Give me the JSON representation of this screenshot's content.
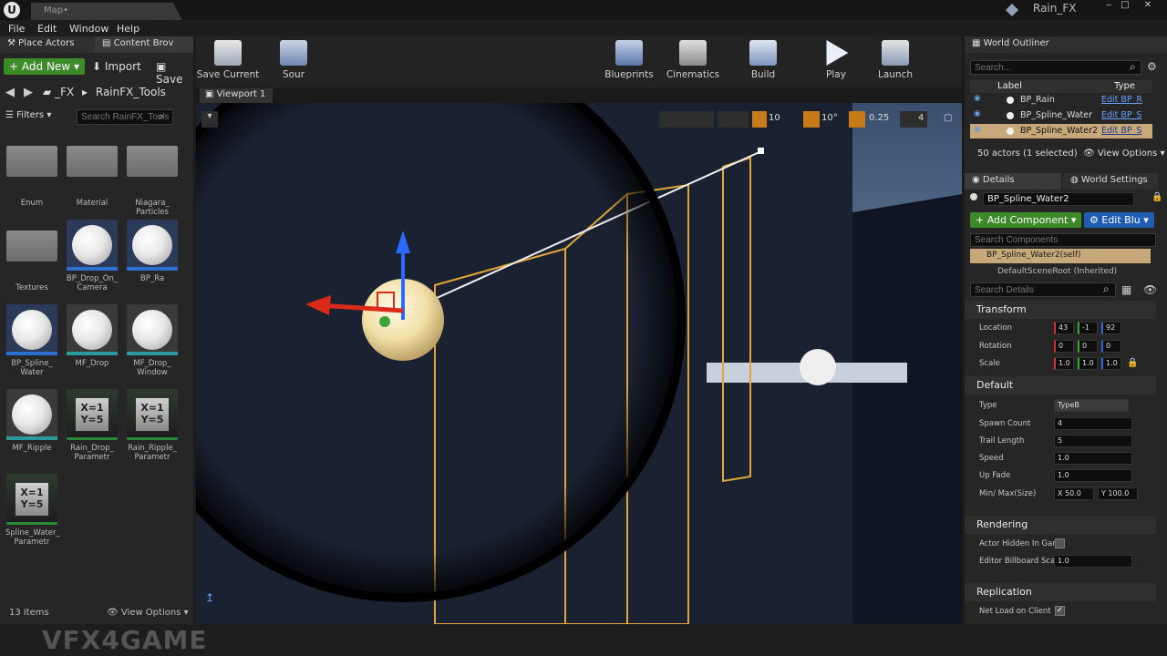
{
  "window": {
    "doc_tab": "Map•",
    "project": "Rain_FX",
    "logo": "U"
  },
  "menu": [
    "File",
    "Edit",
    "Window",
    "Help"
  ],
  "left": {
    "tabs": [
      "Place Actors",
      "Content Brov"
    ],
    "add_new": "Add New",
    "import": "Import",
    "save": "Save",
    "path": [
      "_FX",
      "RainFX_Tools"
    ],
    "filters": "Filters",
    "search_placeholder": "Search RainFX_Tools",
    "assets": [
      {
        "label": "Enum",
        "kind": "folder"
      },
      {
        "label": "Material",
        "kind": "folder"
      },
      {
        "label": "Niagara_ Particles",
        "kind": "folder"
      },
      {
        "label": "Textures",
        "kind": "folder"
      },
      {
        "label": "BP_Drop_On_ Camera",
        "kind": "sphere-bp"
      },
      {
        "label": "BP_Ra",
        "kind": "sphere-bp"
      },
      {
        "label": "BP_Spline_ Water",
        "kind": "sphere-bp"
      },
      {
        "label": "MF_Drop",
        "kind": "sphere-mf"
      },
      {
        "label": "MF_Drop_ Window",
        "kind": "sphere-mf"
      },
      {
        "label": "MF_Ripple",
        "kind": "sphere-mf"
      },
      {
        "label": "Rain_Drop_ Parametr",
        "kind": "param"
      },
      {
        "label": "Rain_Ripple_ Parametr",
        "kind": "param"
      },
      {
        "label": "Spline_Water_ Parametr",
        "kind": "param"
      }
    ],
    "param_icon": "X=1\nY=5",
    "items_count": "13 items",
    "view_options": "View Options"
  },
  "toolbar": [
    {
      "label": "Save Current",
      "icon": "save-icon"
    },
    {
      "label": "Sour",
      "icon": "source-control-icon"
    },
    {
      "label": "Blueprints",
      "icon": "blueprints-icon"
    },
    {
      "label": "Cinematics",
      "icon": "cinematics-icon"
    },
    {
      "label": "Build",
      "icon": "build-icon"
    },
    {
      "label": "Play",
      "icon": "play-icon"
    },
    {
      "label": "Launch",
      "icon": "launch-icon"
    }
  ],
  "viewport": {
    "tab": "Viewport 1",
    "grid": "10",
    "angle": "10°",
    "scale": "0.25",
    "cam": "4"
  },
  "outliner": {
    "title": "World Outliner",
    "search_placeholder": "Search...",
    "col_label": "Label",
    "col_type": "Type",
    "rows": [
      {
        "label": "BP_Rain",
        "type": "Edit BP_R",
        "selected": false
      },
      {
        "label": "BP_Spline_Water",
        "type": "Edit BP_S",
        "selected": false
      },
      {
        "label": "BP_Spline_Water2",
        "type": "Edit BP_S",
        "selected": true
      }
    ],
    "count": "50 actors (1 selected)",
    "view_options": "View Options"
  },
  "details": {
    "tab": "Details",
    "tab2": "World Settings",
    "name": "BP_Spline_Water2",
    "add_component": "Add Component",
    "edit_bp": "Edit Blu",
    "search_components": "Search Components",
    "component_self": "BP_Spline_Water2(self)",
    "component_root": "DefaultSceneRoot (Inherited)",
    "search_details": "Search Details",
    "transform": "Transform",
    "location": {
      "label": "Location",
      "x": "43",
      "y": "-1",
      "z": "92"
    },
    "rotation": {
      "label": "Rotation",
      "x": "0",
      "y": "0",
      "z": "0"
    },
    "scale": {
      "label": "Scale",
      "x": "1.0",
      "y": "1.0",
      "z": "1.0"
    },
    "default": "Default",
    "type": {
      "label": "Type",
      "value": "TypeB"
    },
    "spawn_count": {
      "label": "Spawn Count",
      "value": "4"
    },
    "trail_length": {
      "label": "Trail Length",
      "value": "5"
    },
    "speed": {
      "label": "Speed",
      "value": "1.0"
    },
    "up_fade": {
      "label": "Up Fade",
      "value": "1.0"
    },
    "minmax": {
      "label": "Min/ Max(Size)",
      "x": "X 50.0",
      "y": "Y 100.0"
    },
    "rendering": "Rendering",
    "hidden": {
      "label": "Actor Hidden In Gam"
    },
    "billboard": {
      "label": "Editor Billboard Scal",
      "value": "1.0"
    },
    "replication": "Replication",
    "net_load": {
      "label": "Net Load on Client"
    }
  },
  "watermark": "VFX4GAME"
}
